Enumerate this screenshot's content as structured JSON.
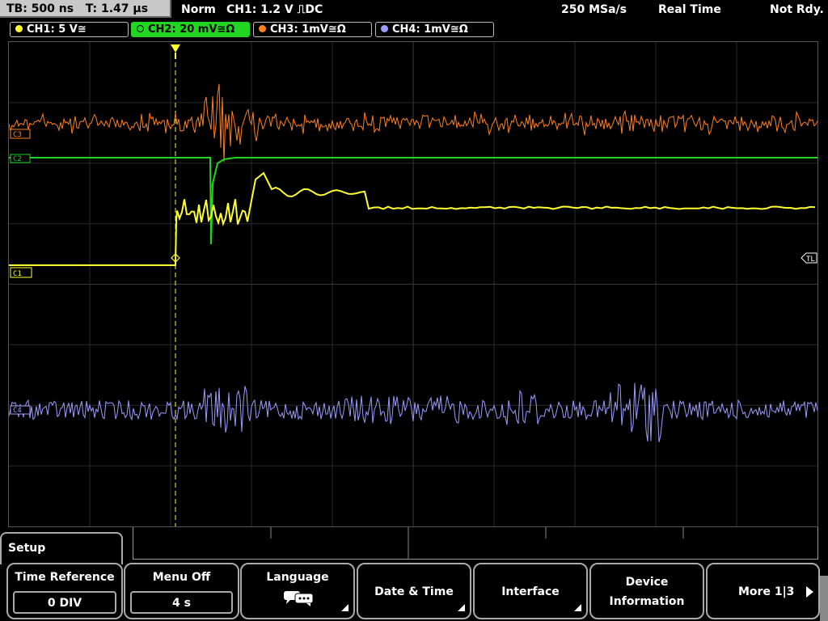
{
  "status": {
    "timebase": "TB: 500 ns",
    "trigger_time": "T: 1.47 µs",
    "mode": "Norm",
    "trigger": "CH1: 1.2 V ⎍DC",
    "sample_rate": "250 MSa/s",
    "acq_mode": "Real Time",
    "ready": "Not Rdy."
  },
  "channels": [
    {
      "label": "CH1: 5 V≅",
      "color": "#ffff30",
      "active": false
    },
    {
      "label": "CH2: 20 mV≅Ω",
      "color": "#22d522",
      "active": true
    },
    {
      "label": "CH3: 1mV≅Ω",
      "color": "#ff8020",
      "active": false
    },
    {
      "label": "CH4: 1mV≅Ω",
      "color": "#9c9cff",
      "active": false
    }
  ],
  "markers": {
    "c3": "C3",
    "c2": "C2",
    "c1": "C1",
    "c4": "C4",
    "tl": "TL"
  },
  "menu": {
    "title": "Setup",
    "softkeys": [
      {
        "label": "Time Reference",
        "value": "0 DIV"
      },
      {
        "label": "Menu Off",
        "value": "4 s"
      },
      {
        "label": "Language",
        "icon": "speech-bubbles-icon"
      },
      {
        "label": "Date & Time"
      },
      {
        "label": "Interface"
      },
      {
        "label1": "Device",
        "label2": "Information"
      },
      {
        "label": "More 1|3"
      }
    ]
  }
}
